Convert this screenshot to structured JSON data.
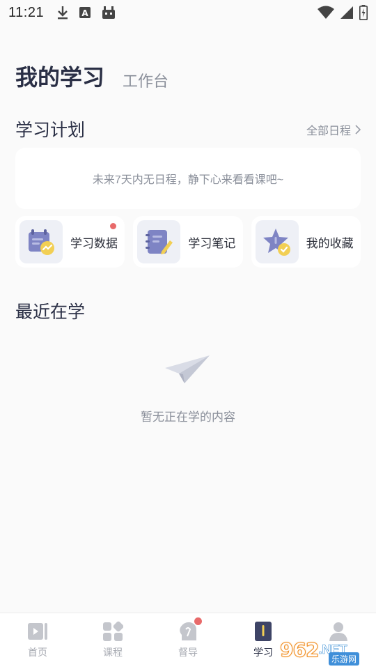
{
  "status_bar": {
    "time": "11:21",
    "icons_left": [
      "download-icon",
      "text-a-icon",
      "android-icon"
    ],
    "icons_right": [
      "wifi-icon",
      "signal-icon",
      "battery-charging-icon"
    ]
  },
  "header": {
    "title": "我的学习",
    "subtitle": "工作台"
  },
  "plan": {
    "title": "学习计划",
    "all_link": "全部日程",
    "empty_text": "未来7天内无日程，静下心来看看课吧~"
  },
  "tools": [
    {
      "label": "学习数据",
      "icon": "study-data-icon",
      "badge": true
    },
    {
      "label": "学习笔记",
      "icon": "notes-icon",
      "badge": false
    },
    {
      "label": "我的收藏",
      "icon": "favorites-star-icon",
      "badge": false
    }
  ],
  "recent": {
    "title": "最近在学",
    "empty_text": "暂无正在学的内容",
    "empty_icon": "paper-plane-icon"
  },
  "bottom_nav": {
    "items": [
      {
        "label": "首页",
        "icon": "home-play-icon",
        "active": false
      },
      {
        "label": "课程",
        "icon": "course-grid-icon",
        "active": false
      },
      {
        "label": "督导",
        "icon": "supervise-head-icon",
        "active": false,
        "badge": true
      },
      {
        "label": "学习",
        "icon": "study-book-icon",
        "active": true
      },
      {
        "label": "",
        "icon": "profile-icon",
        "active": false
      }
    ]
  },
  "watermark": {
    "number": "962",
    "suffix": ".NET",
    "site": "乐游网"
  },
  "colors": {
    "background": "#fafafa",
    "card": "#ffffff",
    "primary_text": "#2a2f45",
    "secondary_text": "#8a8f9a",
    "badge_red": "#e86a6a",
    "icon_blue": "#7e84c4",
    "icon_yellow": "#f2cf54"
  }
}
